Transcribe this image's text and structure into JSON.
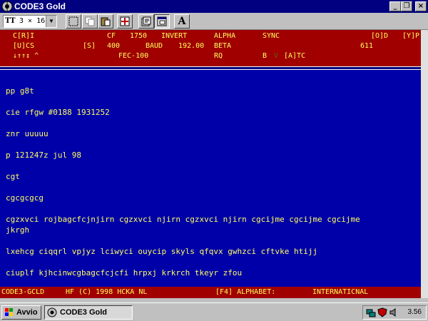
{
  "window": {
    "title": "CODE3 Gold",
    "minimize_glyph": "_",
    "restore_glyph": "❐",
    "close_glyph": "×"
  },
  "toolbar": {
    "font_size_value": "3 × 16",
    "font_icon_glyph": "TT",
    "dropdown_glyph": "▼",
    "buttons": [
      {
        "name": "select-icon",
        "glyph": "⬚"
      },
      {
        "name": "copy-icon",
        "glyph": "❐"
      },
      {
        "name": "paste-icon",
        "glyph": "📋"
      },
      {
        "name": "target-icon",
        "glyph": "⊕"
      },
      {
        "name": "properties-icon",
        "glyph": "☷"
      },
      {
        "name": "window-icon",
        "glyph": "▣"
      },
      {
        "name": "font-icon",
        "glyph": "A"
      }
    ]
  },
  "status": {
    "row1": {
      "cri": "C[R]I",
      "cf_label": "CF",
      "cf_value": "1750",
      "invert": "INVERT",
      "alpha": "ALPHA",
      "sync": "SYNC",
      "od": "[O]D",
      "yp": "[Y]P"
    },
    "row2": {
      "ucs": "[U]CS",
      "s": "[S]",
      "s_value": "400",
      "baud_label": "BAUD",
      "baud_value": "192.00",
      "beta": "BETA",
      "code": "611"
    },
    "row3": {
      "arrows": "↓↑↑↕ ^",
      "fec": "FEC-100",
      "rq": "RQ",
      "b": "B",
      "v": "V",
      "atc": "[A]TC"
    }
  },
  "terminal": {
    "lines": [
      "pp g8t",
      "cie rfgw #0188 1931252",
      "znr uuuuu",
      "p 121247z jul 98",
      "cgt",
      "cgcgcgcg",
      "cgzxvci rojbagcfcjnjirn cgzxvci njirn cgzxvci njirn cgcijme cgcijme cgcijme",
      "jkrgh",
      "lxehcg ciqqrl vpjyz lciwyci ouycip skyls qfqvx gwhzci cftvke htijj",
      "ciuplf kjhcinwcgbagcfcjcfi hrpxj krkrch tkeyr zfou"
    ]
  },
  "footer": {
    "product": "CODE3-GCLD",
    "hf": "HF (C) 1998 HCKA NL",
    "f4": "[F4] ALPHABET:",
    "alphabet": "INTERNATICNAL"
  },
  "taskbar": {
    "start_label": "Avvio",
    "task_label": "CODE3 Gold",
    "clock": "3.56"
  },
  "colors": {
    "title_bar": "#000080",
    "terminal_bg": "#0000a8",
    "terminal_text": "#ffff60",
    "status_bg": "#a00000"
  }
}
